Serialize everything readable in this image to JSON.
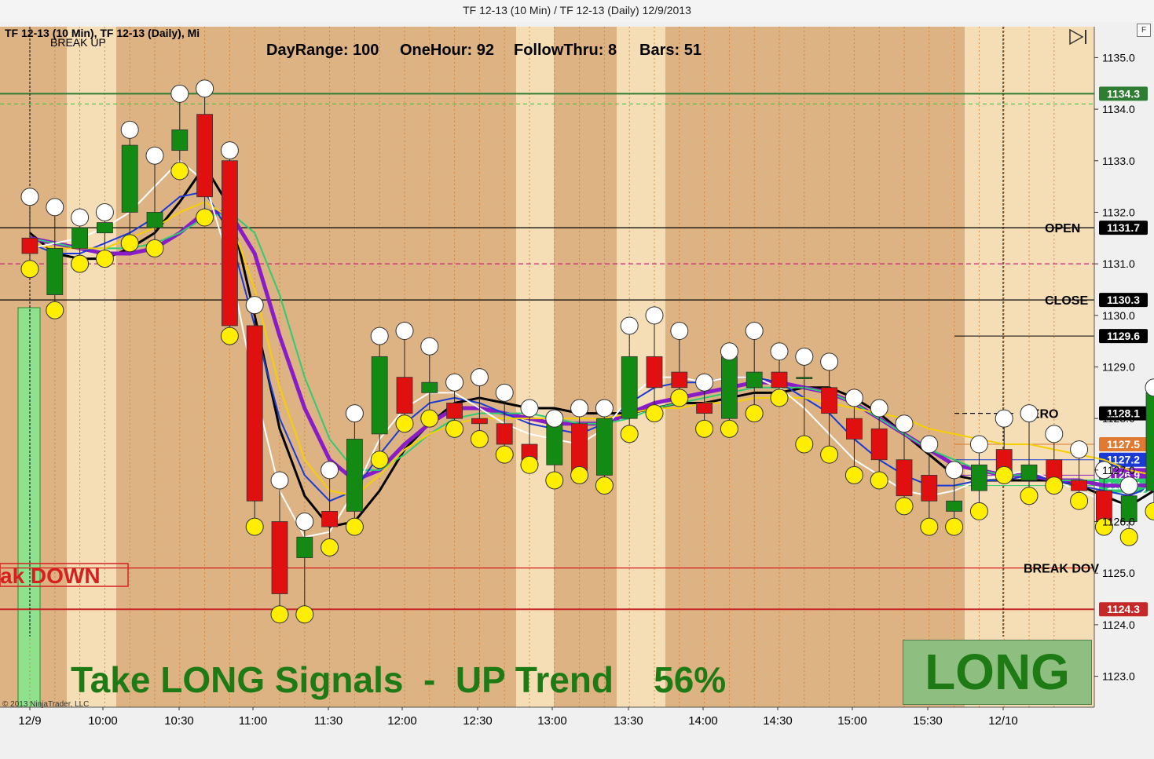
{
  "window": {
    "title": "TF 12-13 (10 Min) / TF 12-13 (Daily)  12/9/2013"
  },
  "panel": {
    "instrument_label": "TF 12-13 (10 Min), TF 12-13 (Daily), Mi",
    "break_up_label": "BREAK UP",
    "stats": {
      "dayrange": "DayRange: 100",
      "onehour": "OneHour: 92",
      "followthru": "FollowThru: 8",
      "bars": "Bars: 51"
    },
    "break_down_left": "ak DOWN",
    "banner": "Take LONG Signals  -  UP Trend    56%",
    "signal": "LONG",
    "copyright": "© 2013 NinjaTrader, LLC",
    "f_button": "F",
    "play_icon": "play-step-icon"
  },
  "chart_data": {
    "type": "candlestick",
    "title": "TF 12-13 (10 Min)",
    "ylim": [
      1122.4,
      1135.6
    ],
    "y_ticks": [
      "1135.0",
      "1134.0",
      "1133.0",
      "1132.0",
      "1131.0",
      "1130.0",
      "1129.0",
      "1128.0",
      "1127.0",
      "1126.0",
      "1125.0",
      "1124.0",
      "1123.0"
    ],
    "x_ticks": [
      "12/9",
      "10:00",
      "10:30",
      "11:00",
      "11:30",
      "12:00",
      "12:30",
      "13:00",
      "13:30",
      "14:00",
      "14:30",
      "15:00",
      "15:30",
      "12/10"
    ],
    "levels": [
      {
        "name": "high",
        "label": "1134.3",
        "value": 1134.3,
        "color": "#2e7d32"
      },
      {
        "name": "open",
        "text": "OPEN",
        "label": "1131.7",
        "value": 1131.7,
        "color": "#000000"
      },
      {
        "name": "close",
        "text": "CLOSE",
        "label": "1130.3",
        "value": 1130.3,
        "color": "#000000"
      },
      {
        "name": "mid",
        "label": "",
        "value": 1131.0,
        "color": "#cc2277"
      },
      {
        "name": "zero",
        "text": "ZERO",
        "label": "1128.1",
        "value": 1128.1,
        "color": "#000000"
      },
      {
        "name": "break_down",
        "text": "BREAK DOV",
        "label": "",
        "value": 1125.1,
        "color": "#d62020"
      },
      {
        "name": "low",
        "label": "1124.3",
        "value": 1124.3,
        "color": "#c62828"
      }
    ],
    "price_labels": [
      {
        "label": "1129.6",
        "value": 1129.6,
        "color": "#000000"
      },
      {
        "label": "1127.5",
        "value": 1127.5,
        "color": "#e07a30"
      },
      {
        "label": "1127.2",
        "value": 1127.2,
        "color": "#1a3ad6"
      },
      {
        "label": "1126.9",
        "value": 1126.9,
        "color": "#8a1cc8"
      },
      {
        "label": "1126.7",
        "value": 1126.7,
        "color": "#2ecc71"
      }
    ],
    "candles": [
      [
        1131.5,
        1132.2,
        1130.9,
        1131.2
      ],
      [
        1130.4,
        1132.1,
        1130.2,
        1131.3
      ],
      [
        1131.3,
        1131.9,
        1131.1,
        1131.7
      ],
      [
        1131.6,
        1132.0,
        1131.2,
        1131.8
      ],
      [
        1132.0,
        1133.6,
        1131.5,
        1133.3
      ],
      [
        1131.7,
        1133.1,
        1131.4,
        1132.0
      ],
      [
        1133.2,
        1134.3,
        1132.9,
        1133.6
      ],
      [
        1133.9,
        1134.3,
        1131.9,
        1132.3
      ],
      [
        1133.0,
        1133.1,
        1129.6,
        1129.8
      ],
      [
        1129.8,
        1130.1,
        1125.9,
        1126.4
      ],
      [
        1126.0,
        1126.7,
        1124.2,
        1124.6
      ],
      [
        1125.3,
        1126.0,
        1124.3,
        1125.7
      ],
      [
        1126.2,
        1126.9,
        1125.5,
        1125.9
      ],
      [
        1126.2,
        1128.1,
        1126.0,
        1127.6
      ],
      [
        1127.7,
        1129.6,
        1127.3,
        1129.2
      ],
      [
        1128.8,
        1129.6,
        1127.9,
        1128.1
      ],
      [
        1128.5,
        1129.4,
        1128.1,
        1128.7
      ],
      [
        1128.3,
        1128.6,
        1127.8,
        1128.0
      ],
      [
        1128.0,
        1128.7,
        1127.6,
        1127.9
      ],
      [
        1127.9,
        1128.4,
        1127.3,
        1127.5
      ],
      [
        1127.5,
        1128.1,
        1127.1,
        1127.2
      ],
      [
        1127.1,
        1128.0,
        1126.9,
        1127.9
      ],
      [
        1127.9,
        1128.1,
        1126.9,
        1126.9
      ],
      [
        1126.9,
        1128.2,
        1126.8,
        1128.0
      ],
      [
        1128.0,
        1129.8,
        1127.8,
        1129.2
      ],
      [
        1129.2,
        1129.9,
        1128.1,
        1128.6
      ],
      [
        1128.9,
        1129.6,
        1128.4,
        1128.6
      ],
      [
        1128.3,
        1128.6,
        1127.8,
        1128.1
      ],
      [
        1128.0,
        1129.3,
        1127.9,
        1129.2
      ],
      [
        1128.6,
        1129.7,
        1128.2,
        1128.9
      ],
      [
        1128.9,
        1129.2,
        1128.4,
        1128.6
      ],
      [
        1128.8,
        1129.2,
        1127.6,
        1128.8
      ],
      [
        1128.6,
        1129.0,
        1127.3,
        1128.1
      ],
      [
        1128.0,
        1128.3,
        1126.9,
        1127.6
      ],
      [
        1127.8,
        1128.1,
        1126.8,
        1127.2
      ],
      [
        1127.2,
        1127.8,
        1126.3,
        1126.5
      ],
      [
        1126.9,
        1127.4,
        1125.9,
        1126.4
      ],
      [
        1126.2,
        1127.0,
        1126.0,
        1126.4
      ],
      [
        1126.6,
        1127.5,
        1126.3,
        1127.1
      ],
      [
        1127.4,
        1127.9,
        1126.9,
        1126.8
      ],
      [
        1126.8,
        1128.1,
        1126.6,
        1127.1
      ],
      [
        1127.2,
        1127.6,
        1126.7,
        1126.8
      ],
      [
        1126.8,
        1127.3,
        1126.4,
        1126.6
      ],
      [
        1126.6,
        1126.9,
        1125.9,
        1126.0
      ],
      [
        1126.0,
        1126.7,
        1125.8,
        1126.5
      ],
      [
        1126.6,
        1128.6,
        1126.3,
        1128.5
      ],
      [
        1129.6,
        1129.8,
        1126.9,
        1128.7
      ],
      [
        1129.6,
        1130.8,
        1126.6,
        1130.8
      ]
    ],
    "series": [
      {
        "name": "",
        "color": "#000000",
        "values": [
          1131.6,
          1131.2,
          1131.1,
          1131.1,
          1131.3,
          1131.6,
          1132.2,
          1132.9,
          1132.1,
          1130.0,
          1127.8,
          1126.5,
          1125.9,
          1126.0,
          1126.6,
          1127.4,
          1127.9,
          1128.3,
          1128.4,
          1128.3,
          1128.2,
          1128.2,
          1128.1,
          1128.1,
          1128.1,
          1128.2,
          1128.3,
          1128.3,
          1128.4,
          1128.5,
          1128.5,
          1128.6,
          1128.6,
          1128.4,
          1128.1,
          1127.7,
          1127.3,
          1126.9,
          1126.8,
          1126.8,
          1126.8,
          1126.8,
          1126.7,
          1126.5,
          1126.3,
          1126.6,
          1127.1,
          1128.1
        ]
      },
      {
        "name": "",
        "color": "#8a1cc8",
        "values": [
          1131.5,
          1131.4,
          1131.3,
          1131.2,
          1131.2,
          1131.3,
          1131.6,
          1132.0,
          1132.0,
          1131.2,
          1129.6,
          1128.2,
          1127.2,
          1126.8,
          1127.0,
          1127.5,
          1127.9,
          1128.2,
          1128.2,
          1128.1,
          1128.0,
          1127.9,
          1127.9,
          1127.9,
          1128.1,
          1128.3,
          1128.4,
          1128.5,
          1128.6,
          1128.7,
          1128.7,
          1128.6,
          1128.5,
          1128.3,
          1128.0,
          1127.7,
          1127.4,
          1127.1,
          1127.0,
          1126.9,
          1126.9,
          1126.8,
          1126.8,
          1126.7,
          1126.7,
          1126.7,
          1126.9,
          1126.9
        ]
      },
      {
        "name": "",
        "color": "#2ecc71",
        "values": [
          1131.5,
          1131.4,
          1131.3,
          1131.3,
          1131.3,
          1131.4,
          1131.6,
          1131.9,
          1132.0,
          1131.6,
          1130.4,
          1128.8,
          1127.6,
          1127.0,
          1127.0,
          1127.3,
          1127.7,
          1128.0,
          1128.1,
          1128.1,
          1128.1,
          1128.0,
          1127.9,
          1127.9,
          1128.0,
          1128.2,
          1128.3,
          1128.4,
          1128.5,
          1128.6,
          1128.6,
          1128.6,
          1128.5,
          1128.3,
          1128.0,
          1127.7,
          1127.4,
          1127.2,
          1127.0,
          1126.9,
          1126.9,
          1126.8,
          1126.8,
          1126.8,
          1126.7,
          1126.6,
          1126.6,
          1126.7
        ]
      },
      {
        "name": "",
        "color": "#1a3ad6",
        "values": [
          1131.4,
          1131.2,
          1131.2,
          1131.4,
          1131.6,
          1131.9,
          1132.3,
          1132.4,
          1131.6,
          1129.8,
          1128.0,
          1126.9,
          1126.4,
          1126.6,
          1127.3,
          1127.9,
          1128.3,
          1128.4,
          1128.3,
          1128.1,
          1127.9,
          1127.8,
          1127.7,
          1127.9,
          1128.3,
          1128.6,
          1128.7,
          1128.7,
          1128.8,
          1128.8,
          1128.7,
          1128.4,
          1128.1,
          1127.6,
          1127.2,
          1126.9,
          1126.7,
          1126.7,
          1126.8,
          1126.8,
          1126.9,
          1126.8,
          1126.7,
          1126.6,
          1126.5,
          1126.7,
          1127.0,
          1127.2
        ]
      },
      {
        "name": "",
        "color": "#f5d000",
        "values": [
          1131.4,
          1131.3,
          1131.3,
          1131.3,
          1131.5,
          1131.7,
          1132.0,
          1132.2,
          1131.9,
          1130.5,
          1128.6,
          1127.2,
          1126.6,
          1126.5,
          1126.9,
          1127.4,
          1127.7,
          1127.9,
          1128.0,
          1128.0,
          1128.0,
          1128.0,
          1128.0,
          1128.0,
          1128.1,
          1128.2,
          1128.2,
          1128.3,
          1128.3,
          1128.4,
          1128.4,
          1128.4,
          1128.3,
          1128.2,
          1128.1,
          1128.0,
          1127.8,
          1127.7,
          1127.6,
          1127.5,
          1127.5,
          1127.4,
          1127.3,
          1127.2,
          1127.0,
          1126.9,
          1127.1,
          1127.3
        ]
      },
      {
        "name": "",
        "color": "#ffffff",
        "values": [
          1131.3,
          1131.4,
          1131.5,
          1131.7,
          1132.0,
          1132.5,
          1133.0,
          1132.6,
          1131.0,
          1128.6,
          1126.6,
          1125.7,
          1125.8,
          1126.6,
          1127.6,
          1128.2,
          1128.5,
          1128.5,
          1128.2,
          1127.9,
          1127.7,
          1127.6,
          1127.5,
          1127.8,
          1128.4,
          1128.8,
          1128.8,
          1128.7,
          1128.8,
          1128.8,
          1128.6,
          1128.2,
          1127.7,
          1127.2,
          1126.9,
          1126.6,
          1126.5,
          1126.6,
          1126.8,
          1126.9,
          1127.0,
          1126.8,
          1126.6,
          1126.4,
          1126.3,
          1126.8,
          1127.4,
          1127.8
        ]
      }
    ]
  }
}
